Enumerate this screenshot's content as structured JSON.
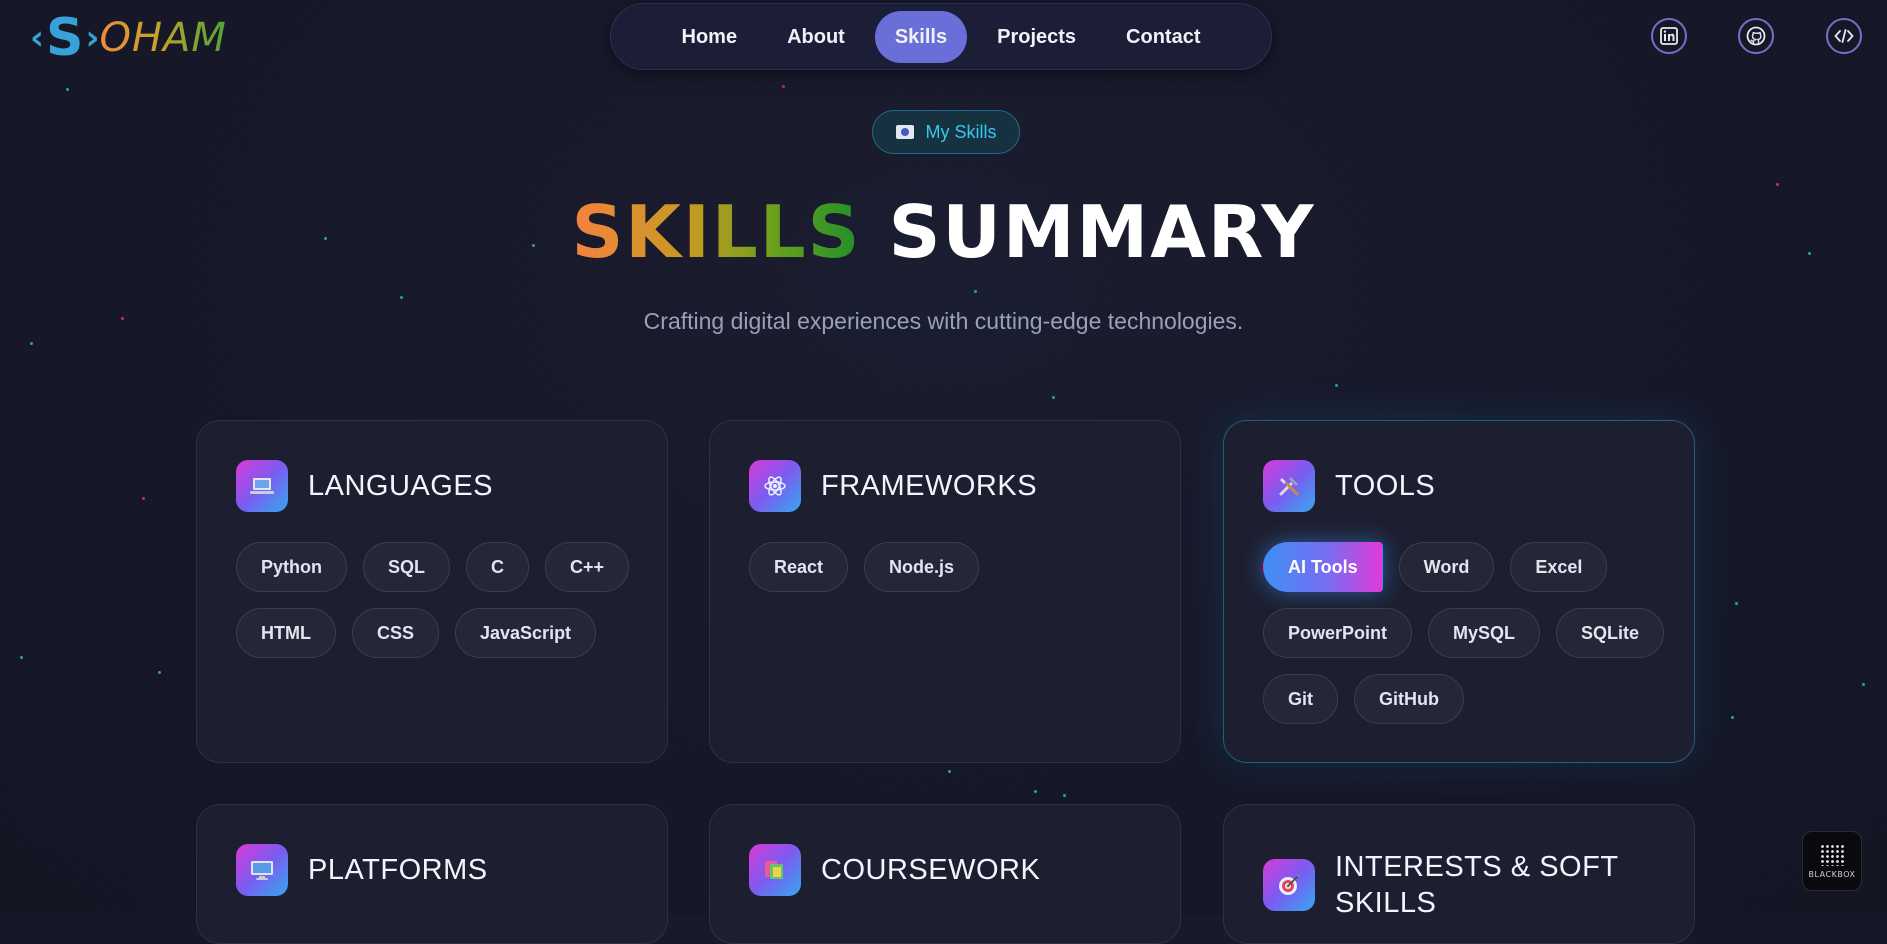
{
  "logo": {
    "left_bracket": "‹",
    "letter": "S",
    "right_bracket": "›",
    "rest": "OHAM"
  },
  "nav": {
    "items": [
      {
        "label": "Home",
        "active": false
      },
      {
        "label": "About",
        "active": false
      },
      {
        "label": "Skills",
        "active": true
      },
      {
        "label": "Projects",
        "active": false
      },
      {
        "label": "Contact",
        "active": false
      }
    ]
  },
  "social": [
    {
      "icon": "linkedin-icon"
    },
    {
      "icon": "github-icon"
    },
    {
      "icon": "code-icon"
    }
  ],
  "hero": {
    "badge_label": "My Skills",
    "title_highlight": "SKILLS",
    "title_rest": "SUMMARY",
    "subtitle": "Crafting digital experiences with cutting-edge technologies."
  },
  "cards": [
    {
      "title": "LANGUAGES",
      "icon": "laptop-icon",
      "chips": [
        "Python",
        "SQL",
        "C",
        "C++",
        "HTML",
        "CSS",
        "JavaScript"
      ]
    },
    {
      "title": "FRAMEWORKS",
      "icon": "atom-icon",
      "chips": [
        "React",
        "Node.js"
      ]
    },
    {
      "title": "TOOLS",
      "icon": "tools-icon",
      "chips": [
        "AI Tools",
        "Word",
        "Excel",
        "PowerPoint",
        "MySQL",
        "SQLite",
        "Git",
        "GitHub"
      ],
      "active_chip": "AI Tools"
    },
    {
      "title": "PLATFORMS",
      "icon": "monitor-icon",
      "chips": []
    },
    {
      "title": "COURSEWORK",
      "icon": "books-icon",
      "chips": []
    },
    {
      "title": "INTERESTS & SOFT SKILLS",
      "icon": "target-icon",
      "chips": []
    }
  ],
  "widget": {
    "label": "BLACKBOX"
  },
  "colors": {
    "accent": "#6a6ed8",
    "badge_text": "#36c6ee",
    "background": "#171929"
  }
}
